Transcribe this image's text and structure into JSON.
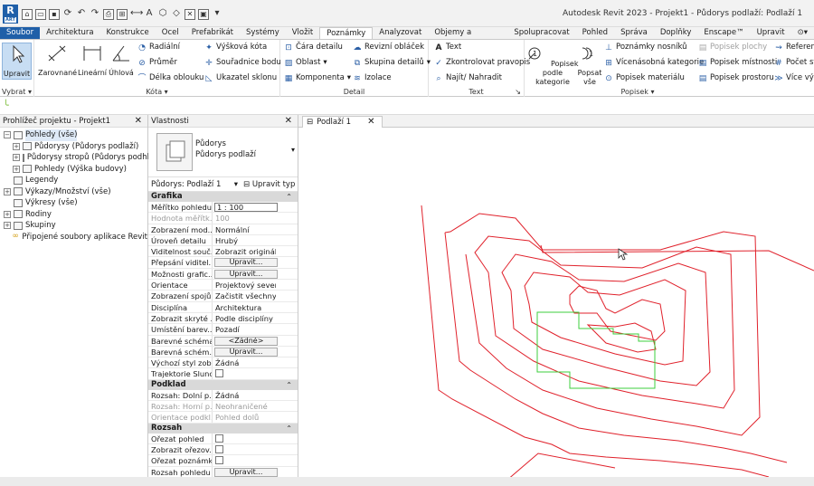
{
  "app": {
    "window_title": "Autodesk Revit 2023 - Projekt1 - Půdorys podlaží: Podlaží 1",
    "logo_text": "R"
  },
  "ribbon_tabs": [
    "Soubor",
    "Architektura",
    "Konstrukce",
    "Ocel",
    "Prefabrikát",
    "Systémy",
    "Vložit",
    "Poznámky",
    "Analyzovat",
    "Objemy a pozemek",
    "Spolupracovat",
    "Pohled",
    "Správa",
    "Doplňky",
    "Enscape™",
    "Upravit"
  ],
  "active_tab": "Poznámky",
  "ribbon": {
    "vybrat": {
      "button": "Upravit",
      "label": "Vybrat"
    },
    "kota": {
      "label": "Kóta",
      "zarovnane": "Zarovnané",
      "linearni": "Lineární",
      "uhlova": "Úhlová",
      "radialni": "Radiální",
      "prumer": "Průměr",
      "delka_oblouku": "Délka oblouku",
      "vyskova_kota": "Výšková kóta",
      "souradnice_bodu": "Souřadnice bodu",
      "ukazatel_sklonu": "Ukazatel sklonu"
    },
    "detail": {
      "label": "Detail",
      "cara_detailu": "Čára detailu",
      "oblast": "Oblast",
      "komponenta": "Komponenta",
      "revizni_oblacek": "Revizní obláček",
      "skupina_detailu": "Skupina detailů",
      "izolace": "Izolace"
    },
    "text": {
      "label": "Text",
      "text": "Text",
      "kontrolovat": "Zkontrolovat pravopis",
      "najit": "Najít/ Nahradit"
    },
    "popisek": {
      "label": "Popisek",
      "podle_kategorie": "Popisek podle kategorie",
      "popsat_vse": "Popsat vše",
      "poznamky_nosniku": "Poznámky nosníků",
      "vicenasobna": "Vícenásobná kategorie",
      "popisek_materialu": "Popisek materiálu",
      "popisek_plochy": "Popisek plochy",
      "popisek_mistnosti": "Popisek místnosti",
      "popisek_prostoru": "Popisek prostoru",
      "referen": "Referen",
      "pocet": "Počet st",
      "vice": "Více vý"
    }
  },
  "project_browser": {
    "title": "Prohlížeč projektu - Projekt1",
    "items": [
      {
        "label": "Pohledy (vše)",
        "level": 0,
        "expander": "−"
      },
      {
        "label": "Půdorysy (Půdorys podlaží)",
        "level": 1,
        "expander": "+"
      },
      {
        "label": "Půdorysy stropů (Půdorys podhledu)",
        "level": 1,
        "expander": "+"
      },
      {
        "label": "Pohledy (Výška budovy)",
        "level": 1,
        "expander": "+"
      },
      {
        "label": "Legendy",
        "level": 0,
        "expander": ""
      },
      {
        "label": "Výkazy/Množství (vše)",
        "level": 0,
        "expander": "+"
      },
      {
        "label": "Výkresy (vše)",
        "level": 0,
        "expander": ""
      },
      {
        "label": "Rodiny",
        "level": 0,
        "expander": "+"
      },
      {
        "label": "Skupiny",
        "level": 0,
        "expander": "+"
      },
      {
        "label": "Připojené soubory aplikace Revit",
        "level": 0,
        "expander": ""
      }
    ]
  },
  "properties": {
    "title": "Vlastnosti",
    "type_line1": "Půdorys",
    "type_line2": "Půdorys podlaží",
    "selector": "Půdorys: Podlaží 1",
    "edit_type": "Upravit typ",
    "sections": [
      {
        "name": "Grafika",
        "rows": [
          {
            "k": "Měřítko pohledu",
            "v": "1 : 100",
            "t": "input"
          },
          {
            "k": "Hodnota měřítk...",
            "v": "100",
            "t": "dis"
          },
          {
            "k": "Zobrazení mod...",
            "v": "Normální",
            "t": "text"
          },
          {
            "k": "Úroveň detailu",
            "v": "Hrubý",
            "t": "text"
          },
          {
            "k": "Viditelnost souč...",
            "v": "Zobrazit originál",
            "t": "text"
          },
          {
            "k": "Přepsání viditel...",
            "v": "Upravit...",
            "t": "btn"
          },
          {
            "k": "Možnosti grafic...",
            "v": "Upravit...",
            "t": "btn"
          },
          {
            "k": "Orientace",
            "v": "Projektový sever",
            "t": "text"
          },
          {
            "k": "Zobrazení spojů...",
            "v": "Začistit všechny ...",
            "t": "text"
          },
          {
            "k": "Disciplína",
            "v": "Architektura",
            "t": "text"
          },
          {
            "k": "Zobrazit skryté ...",
            "v": "Podle disciplíny",
            "t": "text"
          },
          {
            "k": "Umístění barev...",
            "v": "Pozadí",
            "t": "text"
          },
          {
            "k": "Barevné schéma",
            "v": "<Žádné>",
            "t": "btn"
          },
          {
            "k": "Barevná schém...",
            "v": "Upravit...",
            "t": "btn"
          },
          {
            "k": "Výchozí styl zob...",
            "v": "Žádná",
            "t": "text"
          },
          {
            "k": "Trajektorie Slunce",
            "v": "",
            "t": "check"
          }
        ]
      },
      {
        "name": "Podklad",
        "rows": [
          {
            "k": "Rozsah: Dolní p...",
            "v": "Žádná",
            "t": "text"
          },
          {
            "k": "Rozsah: Horní p...",
            "v": "Neohraničené",
            "t": "dis"
          },
          {
            "k": "Orientace podkl...",
            "v": "Pohled dolů",
            "t": "dis"
          }
        ]
      },
      {
        "name": "Rozsah",
        "rows": [
          {
            "k": "Ořezat pohled",
            "v": "",
            "t": "check"
          },
          {
            "k": "Zobrazit ořezov...",
            "v": "",
            "t": "check"
          },
          {
            "k": "Ořezat poznámky",
            "v": "",
            "t": "check"
          },
          {
            "k": "Rozsah pohledu",
            "v": "Upravit...",
            "t": "btn"
          }
        ]
      }
    ]
  },
  "view_tab": {
    "label": "Podlaží 1"
  },
  "colors": {
    "file_tab": "#1f5fa8",
    "contour": "#e0212b",
    "building": "#3ecf3e",
    "section_bg": "#d9d9d9"
  }
}
